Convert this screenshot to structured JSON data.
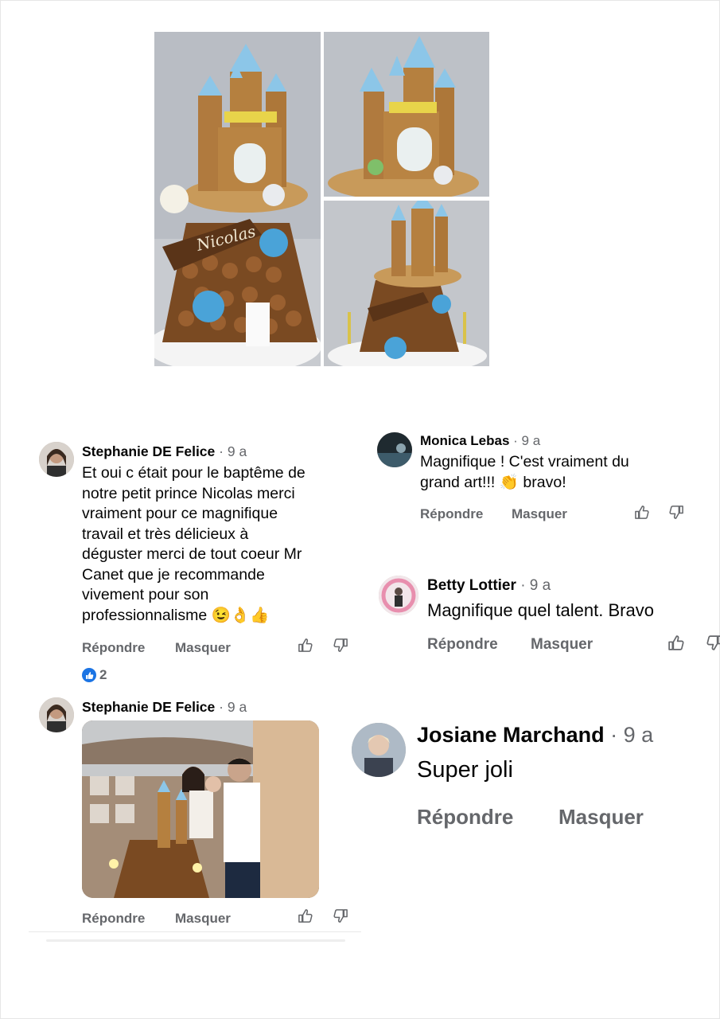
{
  "comments": [
    {
      "author": "Stephanie DE Felice",
      "time": "· 9 a",
      "lines": [
        "Et oui c était pour le baptême de",
        "notre petit prince Nicolas merci",
        "vraiment pour ce magnifique",
        "travail et très délicieux à",
        "déguster merci de tout coeur Mr",
        "Canet que je recommande",
        "vivement pour son",
        "professionnalisme 😉👌👍"
      ],
      "reply": "Répondre",
      "hide": "Masquer",
      "reaction_count": "2"
    },
    {
      "author": "Monica Lebas",
      "time": "· 9 a",
      "lines": [
        "Magnifique ! C'est vraiment du",
        "grand art!!! 👏 bravo!"
      ],
      "reply": "Répondre",
      "hide": "Masquer"
    },
    {
      "author": "Betty Lottier",
      "time": "· 9 a",
      "lines": [
        "Magnifique quel talent. Bravo"
      ],
      "reply": "Répondre",
      "hide": "Masquer"
    },
    {
      "author": "Stephanie DE Felice",
      "time": "· 9 a",
      "reply": "Répondre",
      "hide": "Masquer"
    },
    {
      "author": "Josiane Marchand",
      "time": "· 9 a",
      "lines": [
        "Super joli"
      ],
      "reply": "Répondre",
      "hide": "Masquer"
    }
  ],
  "colors": {
    "meta_gray": "#65676b",
    "like_blue": "#1b74e4",
    "text": "#050505"
  },
  "icons": [
    "thumbs-up-icon",
    "thumbs-down-icon",
    "like-reaction-icon"
  ]
}
